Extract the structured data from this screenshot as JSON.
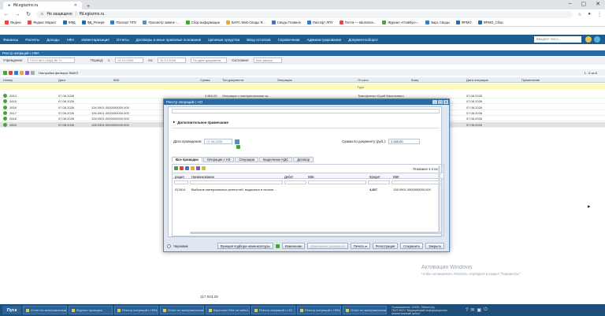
{
  "browser": {
    "tab_title": "ffd.egiszmo.ru",
    "address_warning": "Не защищено",
    "url": "ffd.egiszmo.ru",
    "bookmarks": [
      "Яндекс",
      "Яндекс Маркет",
      "ФФД",
      "ФД_Резерв",
      "Паспорт ППУ",
      "Просмотр заявок -...",
      "Сбор информации",
      "БАРС.Web-Своды Я...",
      "Своды Главное",
      "Паспорт ЛПУ",
      "Почта — talusmina...",
      "Журнал «Главбух»...",
      "Барс Своды",
      "ФРМО",
      "ФРМО_Сбор"
    ]
  },
  "menu": {
    "items": [
      "Финансы",
      "Расчеты",
      "Доходы",
      "НФА",
      "Инвентаризация",
      "Отчеты",
      "Договоры и иные правовые основания",
      "Целевые средства",
      "Ввод остатков",
      "Справочники",
      "Администрирование",
      "Документооборот"
    ],
    "search_placeholder": "Введите текст..."
  },
  "back_window": {
    "title": "Реестр операций с НФА",
    "filters": {
      "institution_label": "Учреждение:",
      "institution_value": "ГБУЗ МСЧ ИЦЦ № 7»",
      "period_label": "Период:",
      "from_label": "с:",
      "from_value": "01.01.2026",
      "to_label": "по:",
      "to_value": "31.12.2026",
      "date_mode": "По дате документа",
      "state_label": "Состояние:",
      "state_value": "Все записи"
    },
    "toolbar_text": "Настройка фильтра: ВЫКЛ",
    "pagination": "1 - 6 из 6",
    "columns": [
      "Номер",
      "Дата",
      "КБК",
      "Сумма",
      "Тип документа",
      "Операция",
      "От кого",
      "Кому",
      "Дата операции",
      "Примечание"
    ],
    "from_filter": "Груз",
    "rows": [
      {
        "num": "2614",
        "date": "07.08.2026",
        "kbk": "",
        "sum": "4 860,00",
        "type": "Операция с материальными за...",
        "from": "Тимофеенко Юрий Васильевич",
        "op_date": "07.08.2026"
      },
      {
        "num": "2615",
        "date": "07.08.2026",
        "kbk": "",
        "sum": "",
        "type": "",
        "from": "Тимофеенко Юрий Васильевич",
        "op_date": "07.08.2026"
      },
      {
        "num": "2616",
        "date": "07.08.2026",
        "kbk": "126.0901.0000000000.000",
        "sum": "",
        "type": "",
        "from": "Тимофеенко Юрий Васильевич",
        "op_date": "07.08.2026"
      },
      {
        "num": "2617",
        "date": "07.08.2026",
        "kbk": "126.0901.0000000000.000",
        "sum": "",
        "type": "",
        "from": "",
        "op_date": "07.08.2026"
      },
      {
        "num": "2618",
        "date": "07.08.2026",
        "kbk": "126.0901.0000000000.000",
        "sum": "",
        "type": "",
        "from": "",
        "op_date": "07.08.2026"
      },
      {
        "num": "2604",
        "date": "07.08.2026",
        "kbk": "126.0901.0000000000.000",
        "sum": "",
        "type": "",
        "from": "",
        "op_date": "07.08.2026"
      }
    ],
    "total": "117 043,29"
  },
  "modal": {
    "title": "Реестр операций с НО",
    "section_title": "Дополнительное примечание",
    "date_label": "Дата проведения:",
    "date_value": "07.08.2026",
    "sum_label": "Сумма по документу (руб.):",
    "sum_value": "2 460,00",
    "tabs": [
      "Все проводки",
      "Операции с НЗ",
      "Операции",
      "Выделение НДС",
      "Договор"
    ],
    "page_info": "Показано 1-4 из 1",
    "grid_columns": [
      "рация",
      "Наименование",
      "Дебет",
      "КБК",
      "Кредит",
      "КБК"
    ],
    "grid_row": {
      "code": "013914",
      "name": "Выбытие материальных ценностей, выданных в личное...",
      "credit": "4,837",
      "kbk": "126.0901.0000000000.000"
    },
    "footer": {
      "draft_label": "Черновик",
      "btn_pick": "Функция подбора номенклатуры",
      "btn_change": "Изменение",
      "btn_disabled": "Изменение документа",
      "btn_print": "Печать",
      "btn_register": "Регистрация",
      "btn_save": "Сохранить",
      "btn_close": "Закрыть"
    }
  },
  "watermark": {
    "line1": "Активация Windows",
    "line2": "Чтобы активировать Windows, перейдите в раздел \"Параметры\"."
  },
  "taskbar": {
    "start": "Пуск",
    "items": [
      "Отчет по материальным запа...",
      "Журнал проводок",
      "Реестр операций с НФА",
      "Отчет по материальным запасам",
      "Карточка НФА на забал...",
      "Реестр операций с НО",
      "Реестр операций с НФА",
      "Отчет по материальным запа..."
    ],
    "info1": "Пользователь: 12923, Объект(ы):",
    "info2": "ГБУЗ МСЧ \"Медицинский информационно-аналитический центр\""
  }
}
